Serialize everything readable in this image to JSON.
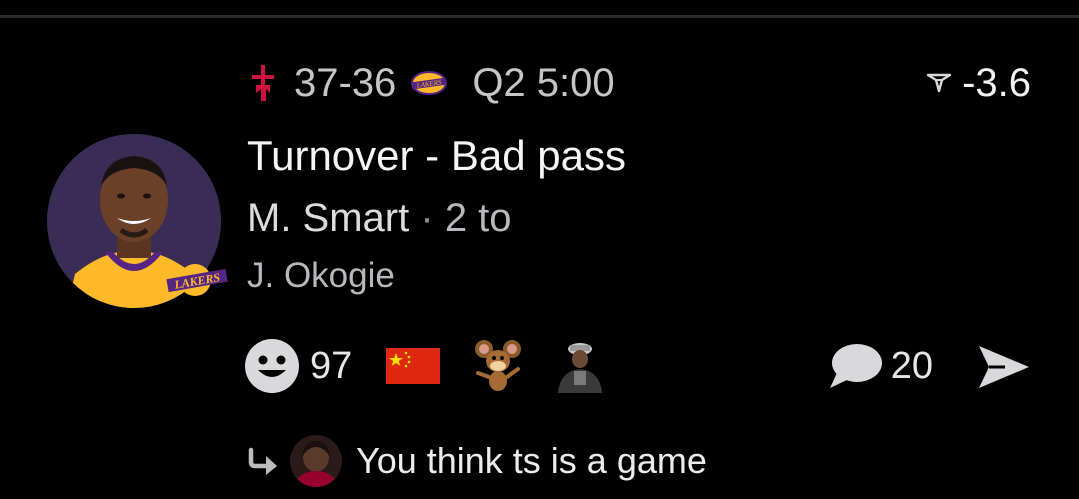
{
  "game": {
    "home_team_icon": "rockets-logo-icon",
    "score": "37-36",
    "away_team_icon": "lakers-logo-icon",
    "clock": "Q2 5:00",
    "spread_icon": "odds-icon",
    "spread": "-3.6"
  },
  "play": {
    "title": "Turnover - Bad pass",
    "player": "M. Smart",
    "separator": "·",
    "connector": "2 to",
    "receiver": "J. Okogie",
    "player_team_badge": "lakers-badge-icon"
  },
  "reactions": {
    "smiley_icon": "smiley-icon",
    "count": "97",
    "emoji": [
      "china-flag-icon",
      "jerry-mouse-icon",
      "person-sticker-icon"
    ]
  },
  "comments": {
    "icon": "comment-bubble-icon",
    "count": "20",
    "share_icon": "share-icon"
  },
  "reply": {
    "icon": "reply-arrow-icon",
    "text": "You think ts is a game"
  },
  "colors": {
    "background": "#000000",
    "rockets_red": "#ce1141",
    "lakers_purple": "#552583",
    "lakers_gold": "#fdb927",
    "muted_text": "#c6c6c8"
  }
}
